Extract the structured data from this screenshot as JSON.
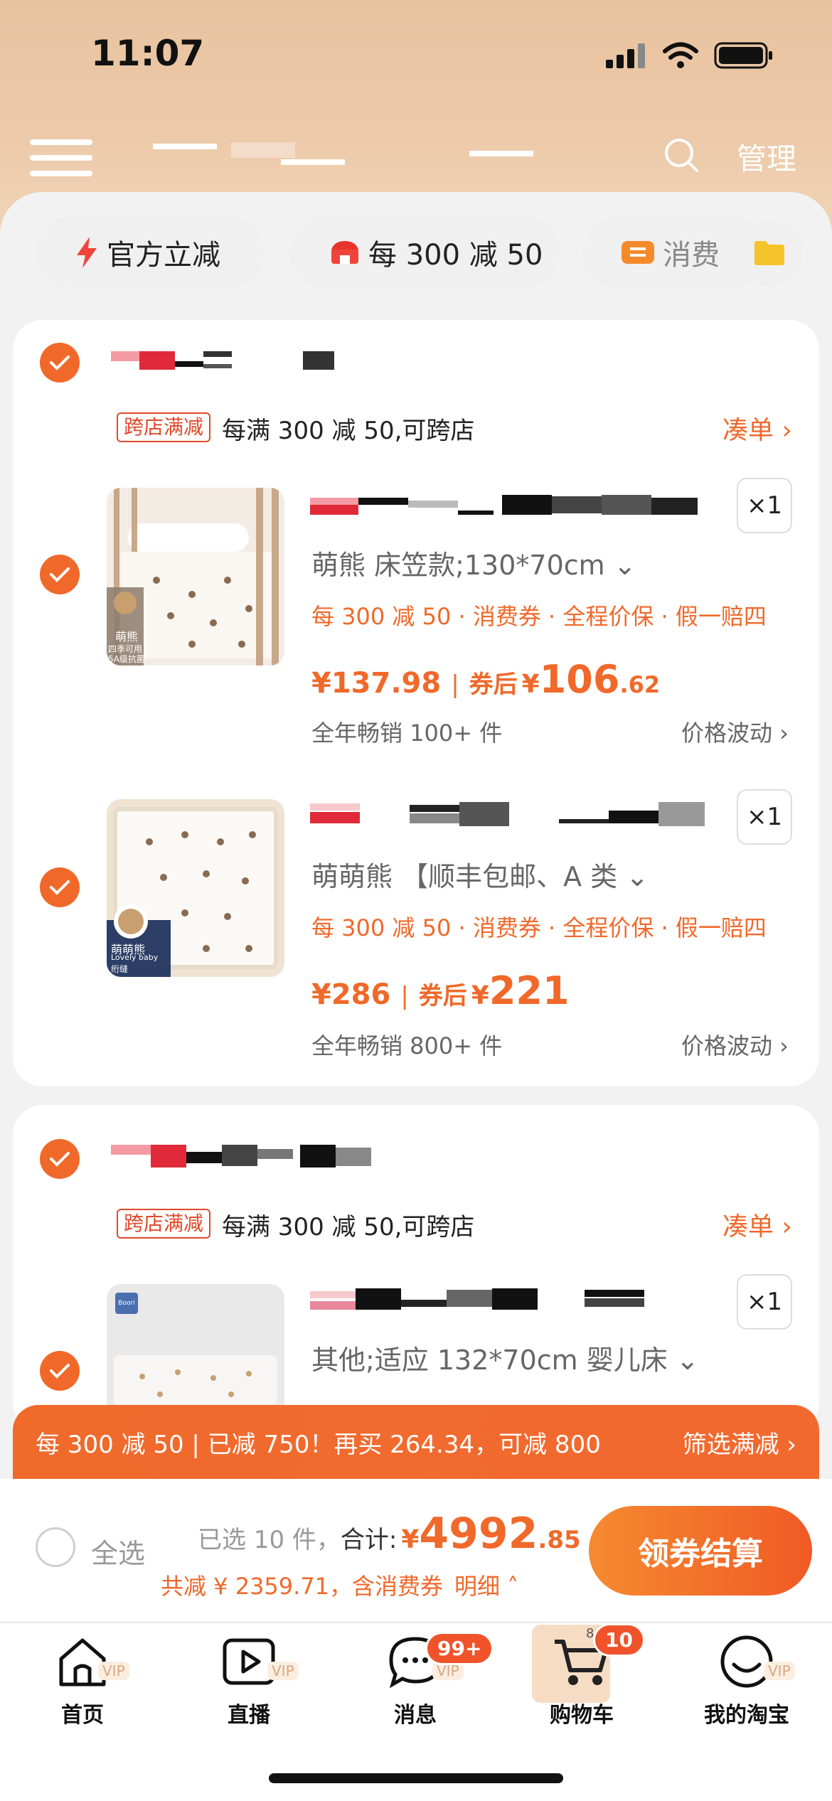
{
  "status_bar": {
    "time": "11:07"
  },
  "header": {
    "manage_label": "管理"
  },
  "filter_chips": [
    {
      "label": "官方立减",
      "icon": "lightning-icon"
    },
    {
      "label": "每 300 减 50",
      "icon": "shop-icon"
    },
    {
      "label": "消费",
      "icon": "coupon-icon"
    }
  ],
  "stores": [
    {
      "promo_tag": "跨店满减",
      "promo_text": "每满 300 减 50,可跨店",
      "gather_label": "凑单 ›",
      "items": [
        {
          "variant": "萌熊 床笠款;130*70cm ⌄",
          "benefits": "每 300 减 50 · 消费券 · 全程价保 · 假一赔四",
          "price": "¥137.98",
          "after_label": "券后",
          "after_currency": "¥",
          "after_int": "106",
          "after_dec": ".62",
          "sold": "全年畅销 100+ 件",
          "fluctuation": "价格波动 ›",
          "qty": "×1",
          "thumb_caption": "萌熊",
          "thumb_sub1": "四季可用",
          "thumb_sub2": "5A级抗菌"
        },
        {
          "variant": "萌萌熊 【顺丰包邮、A 类 ⌄",
          "benefits": "每 300 减 50 · 消费券 · 全程价保 · 假一赔四",
          "price": "¥286",
          "after_label": "券后",
          "after_currency": "¥",
          "after_int": "221",
          "after_dec": "",
          "sold": "全年畅销 800+ 件",
          "fluctuation": "价格波动 ›",
          "qty": "×1",
          "thumb_caption": "萌萌熊",
          "thumb_sub1": "Lovely baby",
          "thumb_sub2": "绗缝"
        }
      ]
    },
    {
      "promo_tag": "跨店满减",
      "promo_text": "每满 300 减 50,可跨店",
      "gather_label": "凑单 ›",
      "items": [
        {
          "variant": "其他;适应 132*70cm 婴儿床 ⌄",
          "qty": "×1",
          "thumb_logo": "Boori"
        }
      ]
    }
  ],
  "promo_bar": {
    "text": "每 300 减 50 | 已减 750！再买 264.34，可减 800",
    "action": "筛选满减 ›"
  },
  "checkout": {
    "select_all": "全选",
    "selected_count": "已选 10 件，",
    "total_label": "合计:",
    "total_currency": "¥",
    "total_int": "4992",
    "total_dec": ".85",
    "discount_text": "共减 ¥ 2359.71，含消费券",
    "detail_label": "明细 ˄",
    "button_label": "领券结算"
  },
  "tabbar": {
    "tabs": [
      {
        "label": "首页",
        "icon": "home-icon",
        "vip": "VIP"
      },
      {
        "label": "直播",
        "icon": "live-play-icon",
        "vip": "VIP"
      },
      {
        "label": "消息",
        "icon": "message-icon",
        "vip": "VIP",
        "badge": "99+"
      },
      {
        "label": "购物车",
        "icon": "cart-icon",
        "badge": "10",
        "partial": "8"
      },
      {
        "label": "我的淘宝",
        "icon": "smile-icon",
        "vip": "VIP"
      }
    ]
  },
  "colors": {
    "accent": "#f0692a",
    "header": "#e8c3a0",
    "tag_red": "#e0492a"
  }
}
